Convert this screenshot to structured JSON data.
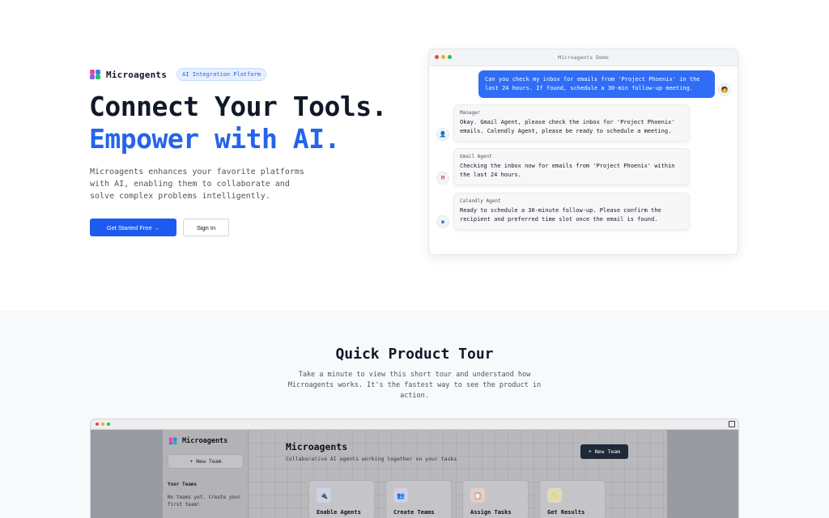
{
  "brand": {
    "name": "Microagents",
    "badge": "AI Integration Platform"
  },
  "hero": {
    "title_line1": "Connect Your Tools.",
    "title_line2": "Empower with AI.",
    "description": "Microagents enhances your favorite platforms with AI, enabling them to collaborate and solve complex problems intelligently.",
    "primary_button": "Get Started Free →",
    "secondary_button": "Sign In"
  },
  "demo": {
    "window_title": "Microagents Demo",
    "user_message": "Can you check my inbox for emails from 'Project Phoenix' in the last 24 hours. If found, schedule a 30-min follow-up meeting.",
    "messages": [
      {
        "sender": "Manager",
        "text": "Okay. Gmail Agent, please check the inbox for 'Project Phoenix' emails. Calendly Agent, please be ready to schedule a meeting.",
        "icon": "manager-avatar-icon"
      },
      {
        "sender": "Gmail Agent",
        "text": "Checking the inbox now for emails from 'Project Phoenix' within the last 24 hours.",
        "icon": "gmail-icon"
      },
      {
        "sender": "Calendly Agent",
        "text": "Ready to schedule a 30-minute follow-up. Please confirm the recipient and preferred time slot once the email is found.",
        "icon": "calendly-icon"
      }
    ]
  },
  "tour": {
    "title": "Quick Product Tour",
    "description": "Take a minute to view this short tour and understand how Microagents works. It's the fastest way to see the product in action."
  },
  "app_preview": {
    "sidebar_brand": "Microagents",
    "sidebar_new_team": "+ New Team",
    "sidebar_section": "Your Teams",
    "sidebar_empty": "No teams yet. Create your first team!",
    "main_title": "Microagents",
    "main_subtitle": "Collaborative AI agents working together on your tasks",
    "main_new_team": "+ New Team",
    "cards": [
      {
        "label": "Enable Agents",
        "icon": "plug-icon",
        "color": "#c9d4ea"
      },
      {
        "label": "Create Teams",
        "icon": "users-icon",
        "color": "#d6cce6"
      },
      {
        "label": "Assign Tasks",
        "icon": "clipboard-icon",
        "color": "#e6cdc8"
      },
      {
        "label": "Get Results",
        "icon": "sparkle-icon",
        "color": "#dcdcb8"
      }
    ]
  },
  "colors": {
    "accent": "#2563eb",
    "user_bubble": "#2f6df6",
    "dark_button": "#1f2937"
  }
}
